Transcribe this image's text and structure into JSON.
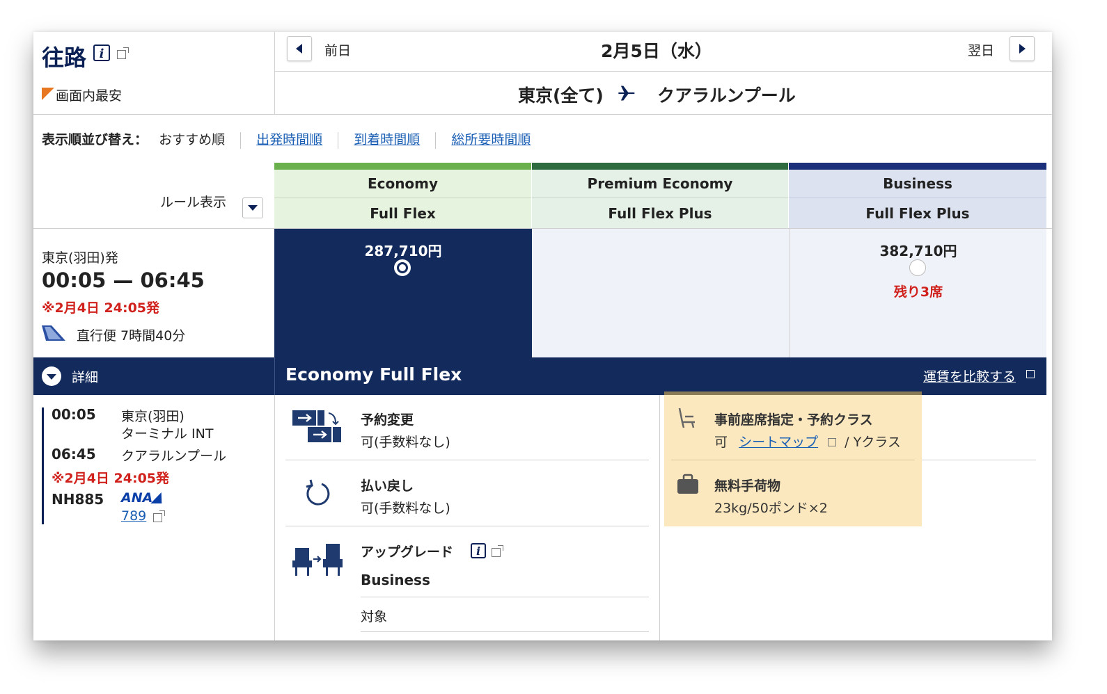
{
  "direction": {
    "title": "往路",
    "cheapest_label": "画面内最安"
  },
  "date_nav": {
    "prev_label": "前日",
    "date": "2月5日（水）",
    "next_label": "翌日"
  },
  "route": {
    "from": "東京(全て)",
    "to": "クアラルンプール"
  },
  "sort": {
    "label": "表示順並び替え：",
    "options": [
      {
        "label": "おすすめ順",
        "active": true
      },
      {
        "label": "出発時間順",
        "active": false
      },
      {
        "label": "到着時間順",
        "active": false
      },
      {
        "label": "総所要時間順",
        "active": false
      }
    ]
  },
  "rules": {
    "label": "ルール表示"
  },
  "fare_columns": [
    {
      "cabin": "Economy",
      "fare": "Full Flex",
      "color": "#6ab04c",
      "head_bg": "#e6f3df",
      "price": "287,710円",
      "selected": true,
      "seats": ""
    },
    {
      "cabin": "Premium Economy",
      "fare": "Full Flex Plus",
      "color": "#2e6b3f",
      "head_bg": "#e5f1e6",
      "price": "",
      "selected": false,
      "seats": ""
    },
    {
      "cabin": "Business",
      "fare": "Full Flex Plus",
      "color": "#1b2f7a",
      "head_bg": "#dde2f1",
      "price": "382,710円",
      "selected": false,
      "seats": "残り3席"
    }
  ],
  "flight": {
    "origin_label": "東京(羽田)発",
    "times": "00:05 — 06:45",
    "note": "※2月4日 24:05発",
    "info": "直行便 7時間40分"
  },
  "details": {
    "toggle_label": "詳細",
    "dep_time": "00:05",
    "dep_airport": "東京(羽田)",
    "dep_terminal": "ターミナル INT",
    "arr_time": "06:45",
    "arr_airport": "クアラルンプール",
    "note": "※2月4日 24:05発",
    "flight_no": "NH885",
    "airline": "ANA",
    "aircraft": "789"
  },
  "selected_fare": {
    "title": "Economy Full Flex",
    "compare_link": "運賃を比較する",
    "features": [
      {
        "icon": "change-reservation-icon",
        "title": "予約変更",
        "value": "可(手数料なし)"
      },
      {
        "icon": "refund-icon",
        "title": "払い戻し",
        "value": "可(手数料なし)"
      },
      {
        "icon": "upgrade-icon",
        "title": "アップグレード",
        "sub_title": "Business",
        "value": "対象"
      }
    ],
    "right_features": [
      {
        "icon": "seat-icon",
        "title": "事前座席指定・予約クラス",
        "prefix": "可",
        "link": "シートマップ",
        "suffix": "/ Yクラス"
      },
      {
        "icon": "baggage-icon",
        "title": "無料手荷物",
        "value": "23kg/50ポンド×2"
      }
    ]
  },
  "colors": {
    "navy": "#0b2155",
    "red": "#d0211c",
    "link": "#1a5fb4",
    "highlight": "#fbe8bf"
  }
}
